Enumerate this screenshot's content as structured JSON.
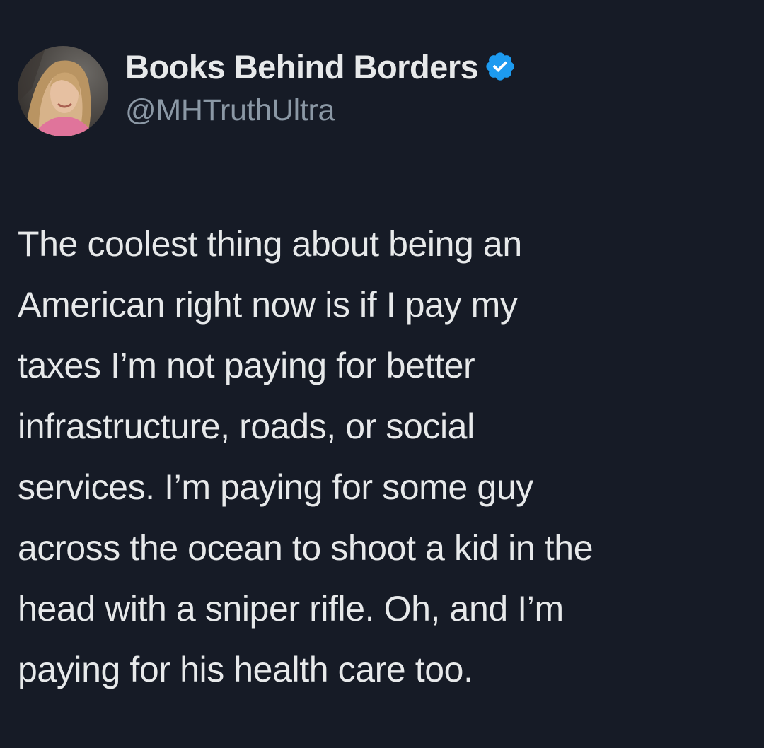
{
  "theme": {
    "background": "#161b26",
    "text_primary": "#e7e9ea",
    "text_secondary": "#8b98a5",
    "verified_badge": "#1d9bf0"
  },
  "author": {
    "display_name": "Books Behind Borders",
    "handle": "@MHTruthUltra",
    "verified": true,
    "verified_icon": "verified-badge-icon",
    "avatar": "profile-photo"
  },
  "tweet": {
    "text": "The coolest thing about being an\nAmerican right now is if I pay my\ntaxes I’m not paying for better\ninfrastructure, roads, or social\nservices. I’m paying for some guy\nacross the ocean to shoot a kid in the\nhead with a sniper rifle. Oh, and I’m\npaying for his health care too."
  }
}
